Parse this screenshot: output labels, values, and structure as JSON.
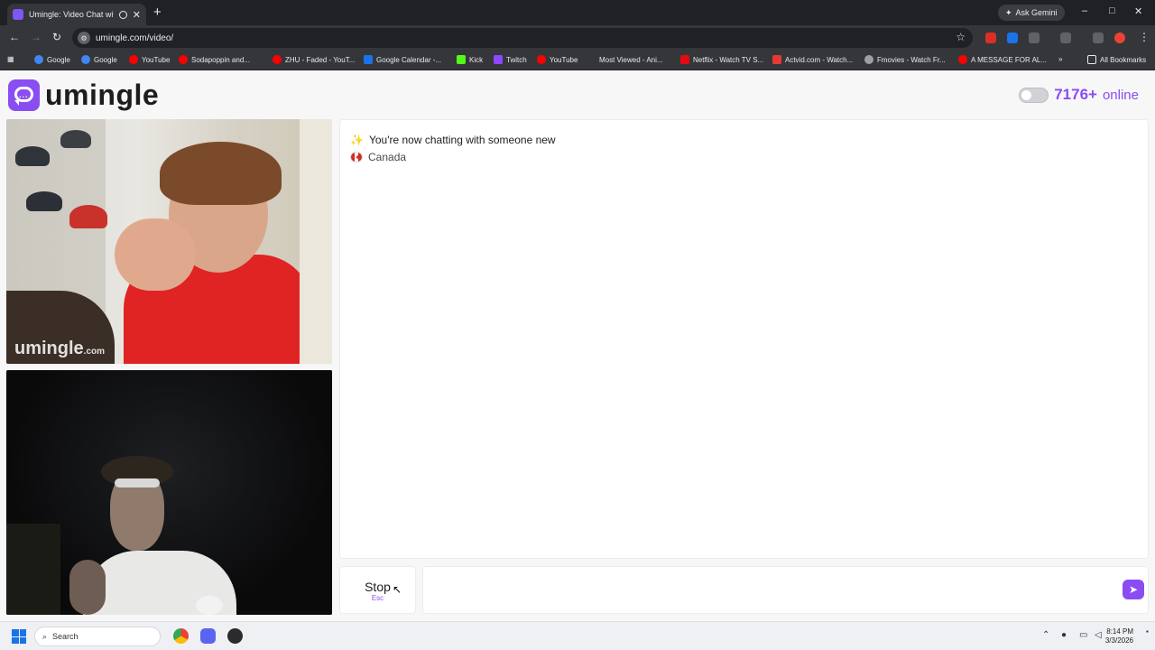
{
  "browser": {
    "tab_title": "Umingle: Video Chat with S",
    "new_tab": "+",
    "ask_gemini": "Ask Gemini",
    "url": "umingle.com/video/",
    "window_controls": [
      "–",
      "□",
      "✕"
    ],
    "bookmarks": [
      {
        "label": "Google",
        "icon": "google-icon",
        "color": "#4285f4"
      },
      {
        "label": "Google",
        "icon": "google-icon",
        "color": "#4285f4"
      },
      {
        "label": "YouTube",
        "icon": "youtube-icon",
        "color": "#ff0000"
      },
      {
        "label": "Sodapoppin and...",
        "icon": "youtube-icon",
        "color": "#ff0000"
      },
      {
        "label": "ZHU - Faded - YouT...",
        "icon": "youtube-icon",
        "color": "#ff0000"
      },
      {
        "label": "Google Calendar -...",
        "icon": "calendar-icon",
        "color": "#1a73e8"
      },
      {
        "label": "Kick",
        "icon": "kick-icon",
        "color": "#53fc18"
      },
      {
        "label": "Twitch",
        "icon": "twitch-icon",
        "color": "#9146ff"
      },
      {
        "label": "YouTube",
        "icon": "youtube-icon",
        "color": "#ff0000"
      },
      {
        "label": "Most Viewed - Ani...",
        "icon": "page-icon",
        "color": "#35363a"
      },
      {
        "label": "Netflix - Watch TV S...",
        "icon": "netflix-icon",
        "color": "#e50914"
      },
      {
        "label": "Actvid.com - Watch...",
        "icon": "actvid-icon",
        "color": "#e53935"
      },
      {
        "label": "Fmovies - Watch Fr...",
        "icon": "globe-icon",
        "color": "#9aa0a6"
      },
      {
        "label": "A MESSAGE FOR AL...",
        "icon": "youtube-icon",
        "color": "#ff0000"
      }
    ],
    "all_bookmarks": "All Bookmarks"
  },
  "site": {
    "logo_text": "umingle",
    "brand_color": "#8a4df2",
    "online_count": "7176+",
    "online_label": "online",
    "watermark": "umingle",
    "watermark_suffix": ".com"
  },
  "chat": {
    "status_message": "You're now chatting with someone new",
    "country": "Canada",
    "input_placeholder": ""
  },
  "controls": {
    "stop_label": "Stop",
    "stop_key": "Esc",
    "send_icon": "send-icon"
  },
  "taskbar": {
    "search_label": "Search",
    "time": "8:14 PM",
    "date": "3/3/2026"
  }
}
